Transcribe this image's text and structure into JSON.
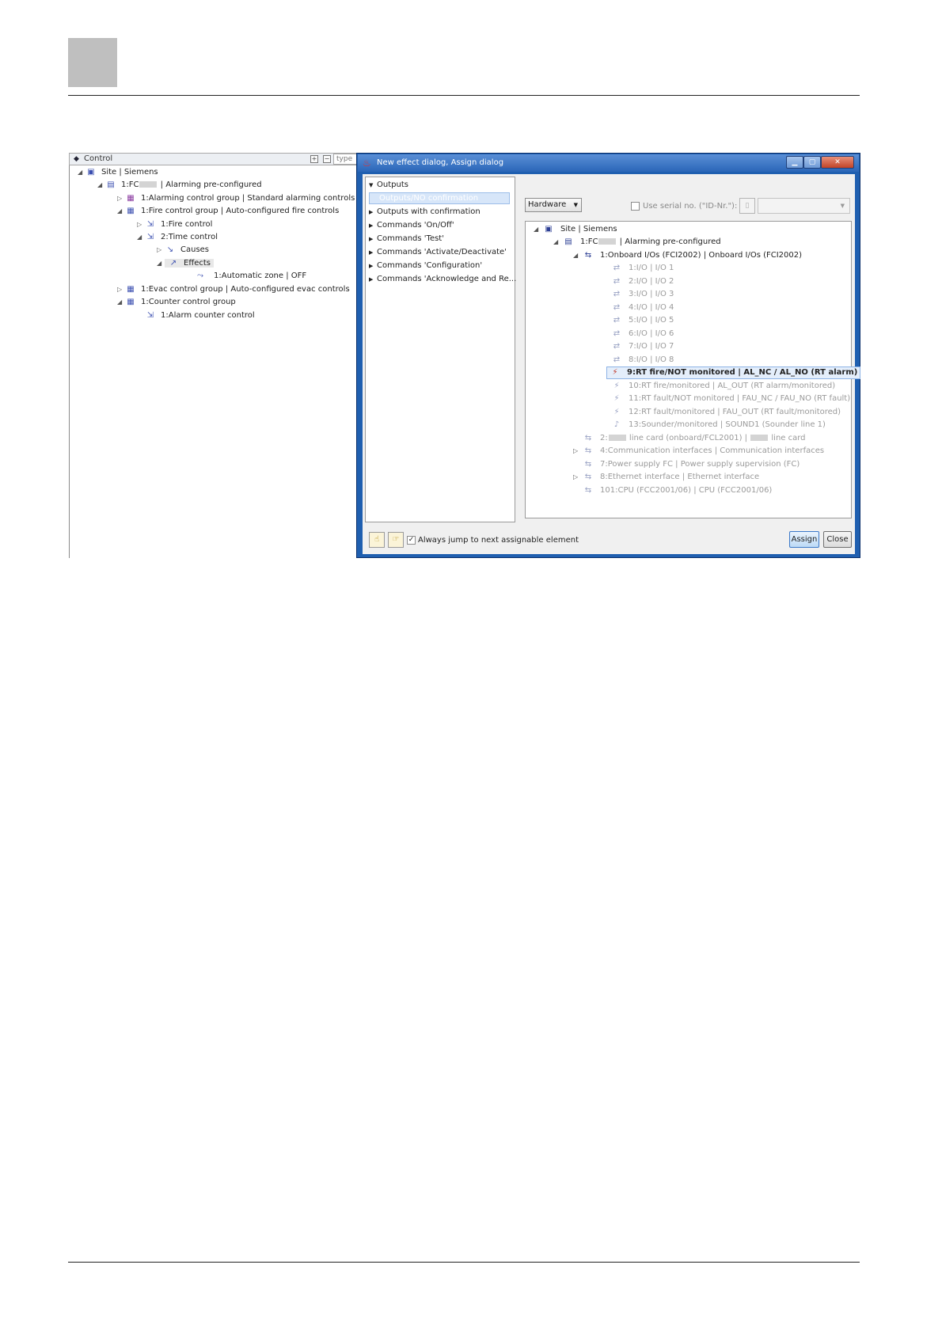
{
  "control_panel": {
    "tab_label": "Control",
    "type_placeholder": "type",
    "tree": [
      {
        "text": "Site | Siemens",
        "expander": "◢",
        "icon": "site-icon"
      },
      {
        "text": "1:FC",
        "suffix": " | Alarming pre-configured",
        "expander": "◢",
        "icon": "panel-icon"
      },
      {
        "text": "1:Alarming control group | Standard alarming controls",
        "expander": "▷",
        "icon": "alarm-group-icon"
      },
      {
        "text": "1:Fire control group | Auto-configured fire controls",
        "expander": "◢",
        "icon": "fire-group-icon"
      },
      {
        "text": "1:Fire control",
        "expander": "▷",
        "icon": "fire-control-icon"
      },
      {
        "text": "2:Time control",
        "expander": "◢",
        "icon": "time-control-icon"
      },
      {
        "text": "Causes",
        "expander": "▷",
        "icon": "causes-icon"
      },
      {
        "text": "Effects",
        "expander": "◢",
        "icon": "effects-icon"
      },
      {
        "text": "1:Automatic zone | OFF",
        "expander": "",
        "icon": "zone-icon"
      },
      {
        "text": "1:Evac control group | Auto-configured evac controls",
        "expander": "▷",
        "icon": "evac-group-icon"
      },
      {
        "text": "1:Counter control group",
        "expander": "◢",
        "icon": "counter-group-icon"
      },
      {
        "text": "1:Alarm counter control",
        "expander": "",
        "icon": "counter-control-icon"
      }
    ]
  },
  "dialog": {
    "title": "New effect dialog, Assign dialog",
    "categories_header": "Outputs",
    "selected_category": "Outputs/NO confirmation",
    "categories": [
      "Outputs with confirmation",
      "Commands 'On/Off'",
      "Commands 'Test'",
      "Commands 'Activate/Deactivate'",
      "Commands 'Configuration'",
      "Commands 'Acknowledge and Re..."
    ],
    "view_dropdown": "Hardware",
    "serial_label": "Use serial no. (\"ID-Nr.\"):",
    "hardware_tree": [
      {
        "text": "Site | Siemens"
      },
      {
        "text": "1:FC",
        "suffix": " | Alarming pre-configured"
      },
      {
        "text": "1:Onboard I/Os (FCI2002) | Onboard I/Os (FCI2002)"
      },
      {
        "text": "1:I/O | I/O 1"
      },
      {
        "text": "2:I/O | I/O 2"
      },
      {
        "text": "3:I/O | I/O 3"
      },
      {
        "text": "4:I/O | I/O 4"
      },
      {
        "text": "5:I/O | I/O 5"
      },
      {
        "text": "6:I/O | I/O 6"
      },
      {
        "text": "7:I/O | I/O 7"
      },
      {
        "text": "8:I/O | I/O 8"
      },
      {
        "text": "9:RT fire/NOT monitored | AL_NC / AL_NO (RT alarm)"
      },
      {
        "text": "10:RT fire/monitored | AL_OUT (RT alarm/monitored)"
      },
      {
        "text": "11:RT fault/NOT monitored | FAU_NC / FAU_NO (RT fault)"
      },
      {
        "text": "12:RT fault/monitored | FAU_OUT (RT fault/monitored)"
      },
      {
        "text": "13:Sounder/monitored | SOUND1 (Sounder line 1)"
      },
      {
        "text": "2:",
        "middle": " line card (onboard/FCL2001) | ",
        "suffix": " line card"
      },
      {
        "text": "4:Communication interfaces | Communication interfaces"
      },
      {
        "text": "7:Power supply FC | Power supply supervision (FC)"
      },
      {
        "text": "8:Ethernet interface | Ethernet interface"
      },
      {
        "text": "101:CPU (FCC2001/06) | CPU (FCC2001/06)"
      }
    ],
    "jump_label": "Always jump to next assignable element",
    "jump_checked": true,
    "assign_label": "Assign",
    "close_label": "Close"
  }
}
